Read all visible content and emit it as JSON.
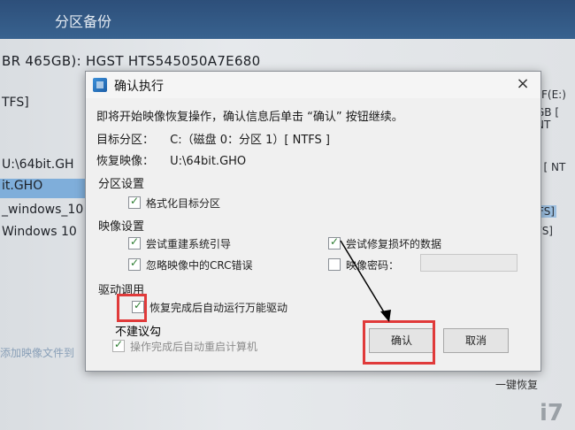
{
  "app": {
    "title": "分区备份",
    "disk_info": "BR 465GB): HGST HTS545050A7E680",
    "left_rows": [
      "TFS]",
      "U:\\64bit.GH",
      "it.GHO",
      "_windows_10",
      "Windows 10"
    ],
    "right_labels": [
      "F(E:)",
      "GB [ NT",
      "] [ NT",
      "FS]",
      "FS]"
    ],
    "add_link": "添加映像文件到",
    "restore_link": "一键恢复",
    "bottom_mark": "i7"
  },
  "dialog": {
    "title": "确认执行",
    "close": "×",
    "message": "即将开始映像恢复操作，确认信息后单击 “确认” 按钮继续。",
    "target_label": "目标分区：",
    "target_value": "C:（磁盘 0：分区 1）[ NTFS ]",
    "source_label": "恢复映像：",
    "source_value": "U:\\64bit.GHO",
    "partition_settings": {
      "heading": "分区设置",
      "format": "格式化目标分区"
    },
    "image_settings": {
      "heading": "映像设置",
      "rebuild_boot": "尝试重建系统引导",
      "repair_data": "尝试修复损坏的数据",
      "ignore_crc": "忽略映像中的CRC错误",
      "image_password": "映像密码："
    },
    "driver": {
      "heading": "驱动调用",
      "auto_driver": "恢复完成后自动运行万能驱动"
    },
    "restart": "操作完成后自动重启计算机",
    "confirm_button": "确认",
    "cancel_button": "取消"
  },
  "annotation": {
    "note": "不建议勾"
  },
  "colors": {
    "highlight": "#e03a3a",
    "titlebar": "#2d4f7a"
  }
}
